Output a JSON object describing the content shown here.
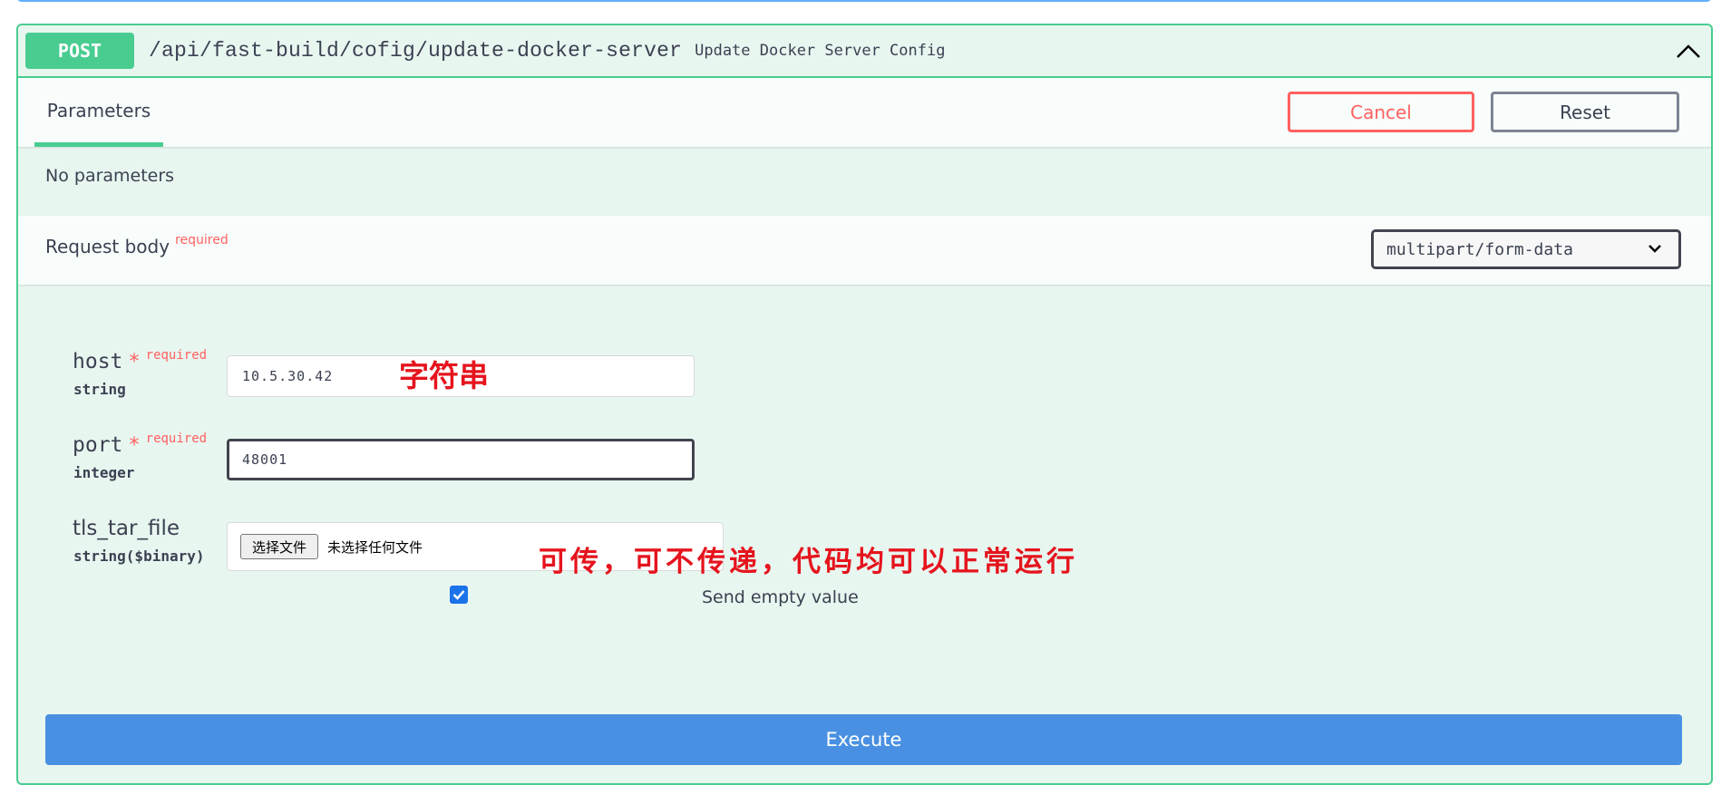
{
  "operation": {
    "method": "POST",
    "path": "/api/fast-build/cofig/update-docker-server",
    "description": "Update Docker Server Config",
    "color": "#49cc90"
  },
  "tabs": {
    "parameters": "Parameters",
    "cancel": "Cancel",
    "reset": "Reset"
  },
  "parameters": {
    "empty_text": "No parameters"
  },
  "request_body": {
    "title": "Request body",
    "required_label": "required",
    "content_type": "multipart/form-data"
  },
  "fields": [
    {
      "name": "host",
      "required_star": "*",
      "required_label": "required",
      "type": "string",
      "value": "10.5.30.42"
    },
    {
      "name": "port",
      "required_star": "*",
      "required_label": "required",
      "type": "integer",
      "value": "48001"
    },
    {
      "name": "tls_tar_file",
      "type": "string($binary)",
      "file_button": "选择文件",
      "file_status": "未选择任何文件",
      "send_empty_checked": true,
      "send_empty_label": "Send empty value"
    }
  ],
  "annotations": {
    "host_note": "字符串",
    "file_note": "可传，可不传递，代码均可以正常运行",
    "color": "#e5141d"
  },
  "execute_label": "Execute",
  "colors": {
    "execute": "#4990e2",
    "cancel": "#ff6060",
    "required": "#ff6060"
  }
}
